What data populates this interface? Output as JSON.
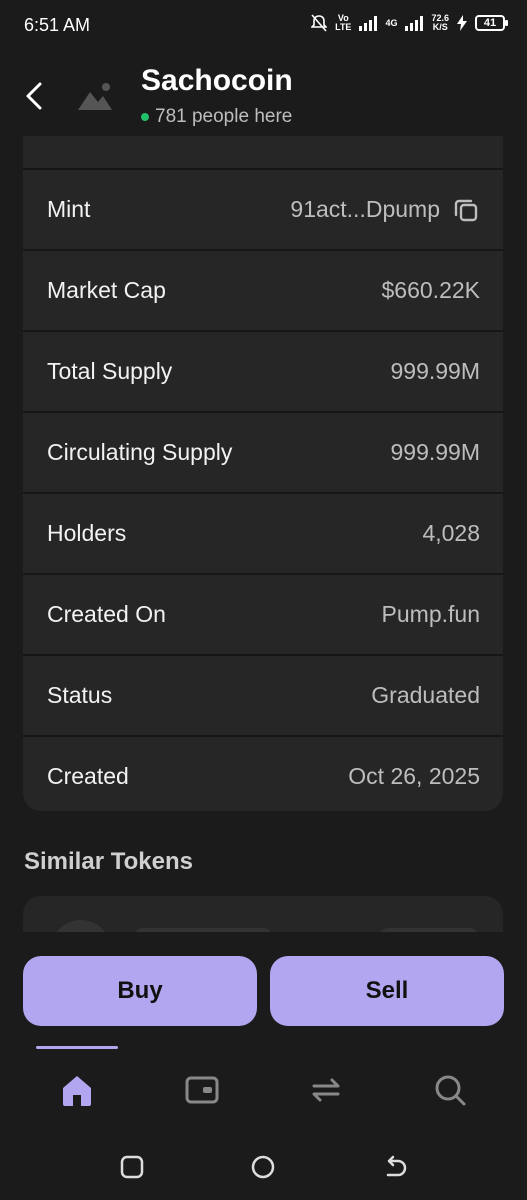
{
  "status_bar": {
    "time": "6:51 AM",
    "volte": "Vo\nLTE",
    "network": "4G",
    "speed_value": "72.6",
    "speed_unit": "K/S",
    "battery": "41",
    "icons": [
      "bell-off-icon",
      "volte-icon",
      "signal-icon",
      "4g-signal-icon",
      "charging-icon",
      "battery-icon"
    ]
  },
  "header": {
    "title": "Sachocoin",
    "presence": "781 people here",
    "presence_color": "#21c06b"
  },
  "details": {
    "rows": [
      {
        "label": "Mint",
        "value": "91act...Dpump",
        "copyable": true
      },
      {
        "label": "Market Cap",
        "value": "$660.22K"
      },
      {
        "label": "Total Supply",
        "value": "999.99M"
      },
      {
        "label": "Circulating Supply",
        "value": "999.99M"
      },
      {
        "label": "Holders",
        "value": "4,028"
      },
      {
        "label": "Created On",
        "value": "Pump.fun"
      },
      {
        "label": "Status",
        "value": "Graduated"
      },
      {
        "label": "Created",
        "value": "Oct 26, 2025"
      }
    ]
  },
  "similar": {
    "title": "Similar Tokens"
  },
  "actions": {
    "buy_label": "Buy",
    "sell_label": "Sell",
    "accent": "#b3a6f0"
  },
  "bottom_nav": {
    "items": [
      "home-icon",
      "wallet-icon",
      "swap-icon",
      "search-icon"
    ],
    "active": "home-icon"
  },
  "system_nav": {
    "items": [
      "recents-icon",
      "home-circle-icon",
      "back-icon"
    ]
  }
}
